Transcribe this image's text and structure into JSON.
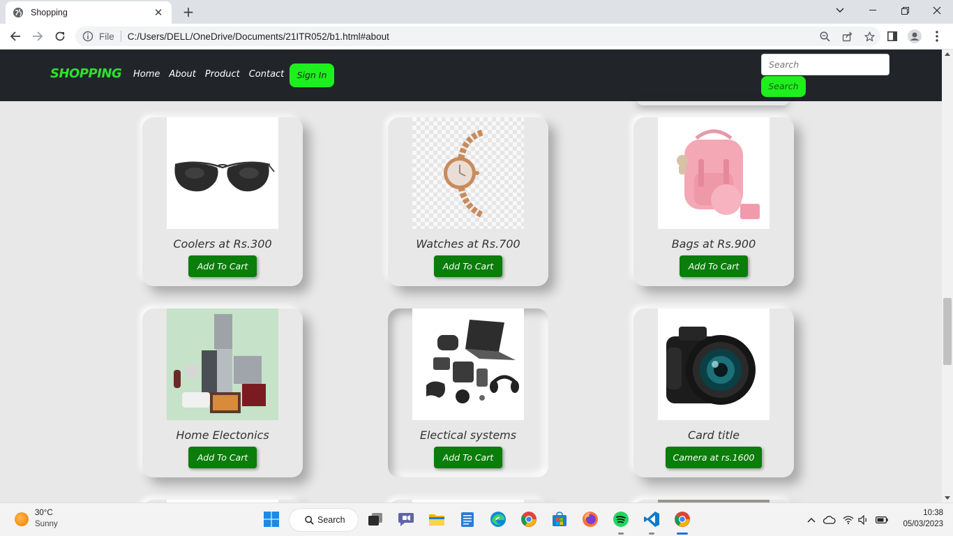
{
  "browser": {
    "tab_title": "Shopping",
    "address_prefix": "File",
    "url": "C:/Users/DELL/OneDrive/Documents/21ITR052/b1.html#about"
  },
  "site": {
    "brand": "SHOPPING",
    "nav_links": [
      "Home",
      "About",
      "Product",
      "Contact"
    ],
    "signin_label": "Sign In",
    "search_placeholder": "Search",
    "search_button": "Search",
    "accent_color": "#1ef01e",
    "button_color": "#0a7d0a"
  },
  "products": [
    {
      "title": "Coolers at Rs.300",
      "button": "Add To Cart",
      "image": "sunglasses"
    },
    {
      "title": "Watches at Rs.700",
      "button": "Add To Cart",
      "image": "watch"
    },
    {
      "title": "Bags at Rs.900",
      "button": "Add To Cart",
      "image": "pink-bag"
    },
    {
      "title": "Home Electonics",
      "button": "Add To Cart",
      "image": "home-appliances"
    },
    {
      "title": "Electical systems",
      "button": "Add To Cart",
      "image": "gadgets"
    },
    {
      "title": "Card title",
      "button": "Camera at rs.1600",
      "image": "camera"
    }
  ],
  "taskbar": {
    "temperature": "30°C",
    "weather": "Sunny",
    "search_label": "Search",
    "time": "10:38",
    "date": "05/03/2023"
  }
}
